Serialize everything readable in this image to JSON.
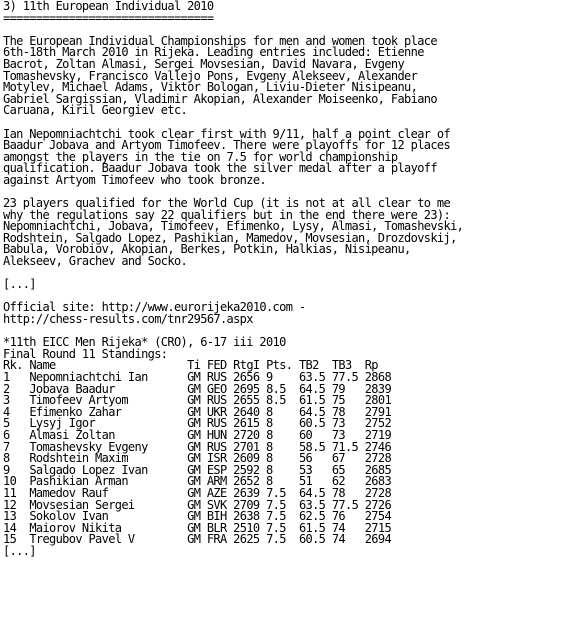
{
  "heading": "3) 11th European Individual 2010",
  "underline": "================================",
  "para1": [
    "The European Individual Championships for men and women took place",
    "6th-18th March 2010 in Rijeka. Leading entries included: Etienne",
    "Bacrot, Zoltan Almasi, Sergei Movsesian, David Navara, Evgeny",
    "Tomashevsky, Francisco Vallejo Pons, Evgeny Alekseev, Alexander",
    "Motylev, Michael Adams, Viktor Bologan, Liviu-Dieter Nisipeanu,",
    "Gabriel Sargissian, Vladimir Akopian, Alexander Moiseenko, Fabiano",
    "Caruana, Kiril Georgiev etc."
  ],
  "para2": [
    "Ian Nepomniachtchi took clear first with 9/11, half a point clear of",
    "Baadur Jobava and Artyom Timofeev. There were playoffs for 12 places",
    "amongst the players in the tie on 7.5 for world championship",
    "qualification. Baadur Jobava took the silver medal after a playoff",
    "against Artyom Timofeev who took bronze."
  ],
  "para3": [
    "23 players qualified for the World Cup (it is not at all clear to me",
    "why the regulations say 22 qualifiers but in the end there were 23):",
    "Nepomniachtchi, Jobava, Timofeev, Efimenko, Lysy, Almasi, Tomashevski,",
    "Rodshtein, Salgado Lopez, Pashikian, Mamedov, Movsesian, Drozdovskij,",
    "Babula, Vorobiov, Akopian, Berkes, Potkin, Halkias, Nisipeanu,",
    "Alekseev, Grachev and Socko."
  ],
  "ellipsis1": "[...]",
  "site_line1": "Official site: http://www.eurorijeka2010.com -",
  "site_line2": "http://chess-results.com/tnr29567.aspx",
  "event_line": "*11th EICC Men Rijeka* (CRO), 6-17 iii 2010",
  "round_line": "Final Round 11 Standings:",
  "standings": {
    "columns": [
      "Rk.",
      "Name",
      "Ti",
      "FED",
      "RtgI",
      "Pts.",
      "TB2",
      "TB3",
      "Rp"
    ],
    "rows": [
      [
        "1",
        "Nepomniachtchi Ian",
        "GM",
        "RUS",
        "2656",
        "9",
        "63.5",
        "77.5",
        "2868"
      ],
      [
        "2",
        "Jobava Baadur",
        "GM",
        "GEO",
        "2695",
        "8.5",
        "64.5",
        "79",
        "2839"
      ],
      [
        "3",
        "Timofeev Artyom",
        "GM",
        "RUS",
        "2655",
        "8.5",
        "61.5",
        "75",
        "2801"
      ],
      [
        "4",
        "Efimenko Zahar",
        "GM",
        "UKR",
        "2640",
        "8",
        "64.5",
        "78",
        "2791"
      ],
      [
        "5",
        "Lysyj Igor",
        "GM",
        "RUS",
        "2615",
        "8",
        "60.5",
        "73",
        "2752"
      ],
      [
        "6",
        "Almasi Zoltan",
        "GM",
        "HUN",
        "2720",
        "8",
        "60",
        "73",
        "2719"
      ],
      [
        "7",
        "Tomashevsky Evgeny",
        "GM",
        "RUS",
        "2701",
        "8",
        "58.5",
        "71.5",
        "2746"
      ],
      [
        "8",
        "Rodshtein Maxim",
        "GM",
        "ISR",
        "2609",
        "8",
        "56",
        "67",
        "2728"
      ],
      [
        "9",
        "Salgado Lopez Ivan",
        "GM",
        "ESP",
        "2592",
        "8",
        "53",
        "65",
        "2685"
      ],
      [
        "10",
        "Pashikian Arman",
        "GM",
        "ARM",
        "2652",
        "8",
        "51",
        "62",
        "2683"
      ],
      [
        "11",
        "Mamedov Rauf",
        "GM",
        "AZE",
        "2639",
        "7.5",
        "64.5",
        "78",
        "2728"
      ],
      [
        "12",
        "Movsesian Sergei",
        "GM",
        "SVK",
        "2709",
        "7.5",
        "63.5",
        "77.5",
        "2726"
      ],
      [
        "13",
        "Sokolov Ivan",
        "GM",
        "BIH",
        "2638",
        "7.5",
        "62.5",
        "76",
        "2754"
      ],
      [
        "14",
        "Maiorov Nikita",
        "GM",
        "BLR",
        "2510",
        "7.5",
        "61.5",
        "74",
        "2715"
      ],
      [
        "15",
        "Tregubov Pavel V",
        "GM",
        "FRA",
        "2625",
        "7.5",
        "60.5",
        "74",
        "2694"
      ]
    ]
  },
  "ellipsis2": "[...]"
}
